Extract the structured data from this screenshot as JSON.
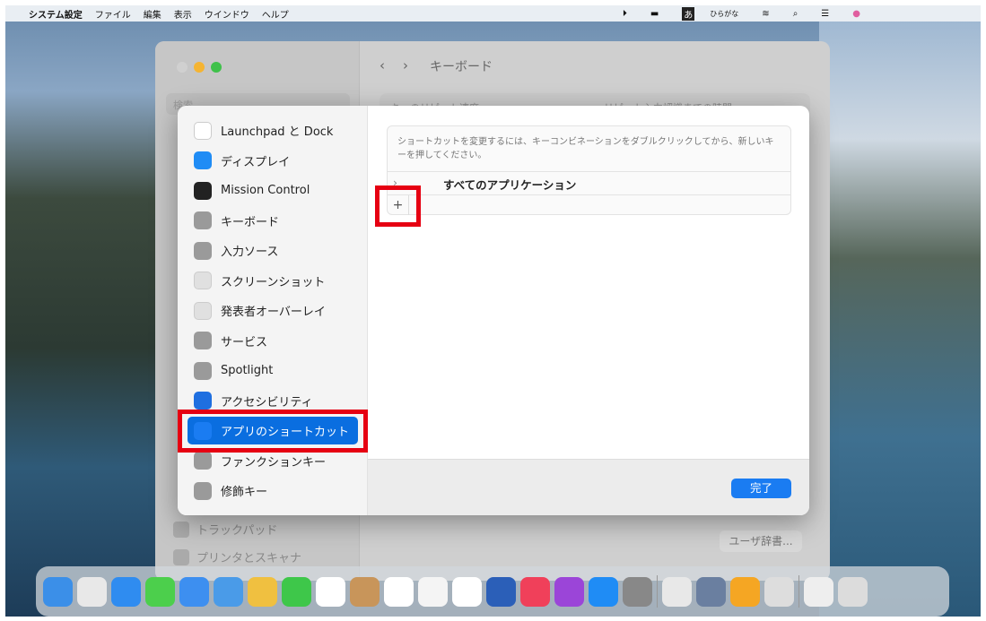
{
  "menubar": {
    "app": "システム設定",
    "items": [
      "ファイル",
      "編集",
      "表示",
      "ウインドウ",
      "ヘルプ"
    ],
    "input_mode_badge": "あ",
    "input_mode": "ひらがな",
    "icons": [
      "play-circle-icon",
      "battery-icon",
      "wifi-icon",
      "search-icon",
      "control-center-icon",
      "siri-icon"
    ]
  },
  "window": {
    "title": "キーボード",
    "back": "‹",
    "forward": "›",
    "search_placeholder": "検索",
    "bg_row_left": "キーのリピート速度",
    "bg_row_right": "リピート入力認識までの時間",
    "bg_sidebar": [
      "トラックパッド",
      "プリンタとスキャナ"
    ],
    "user_dict_button": "ユーザ辞書..."
  },
  "sheet": {
    "sidebar": [
      {
        "label": "Launchpad と Dock",
        "icon": "launchpad-icon",
        "color": "#ffffff"
      },
      {
        "label": "ディスプレイ",
        "icon": "display-icon",
        "color": "#1f8cf5"
      },
      {
        "label": "Mission Control",
        "icon": "mission-control-icon",
        "color": "#222222"
      },
      {
        "label": "キーボード",
        "icon": "keyboard-icon",
        "color": "#9a9a9a"
      },
      {
        "label": "入力ソース",
        "icon": "input-source-icon",
        "color": "#9a9a9a"
      },
      {
        "label": "スクリーンショット",
        "icon": "screenshot-icon",
        "color": "#e0e0e0"
      },
      {
        "label": "発表者オーバーレイ",
        "icon": "presenter-overlay-icon",
        "color": "#e0e0e0"
      },
      {
        "label": "サービス",
        "icon": "services-icon",
        "color": "#9a9a9a"
      },
      {
        "label": "Spotlight",
        "icon": "spotlight-icon",
        "color": "#9a9a9a"
      },
      {
        "label": "アクセシビリティ",
        "icon": "accessibility-icon",
        "color": "#1f6fe0"
      },
      {
        "label": "アプリのショートカット",
        "icon": "app-store-icon",
        "color": "#1a7cf2",
        "selected": true
      },
      {
        "label": "ファンクションキー",
        "icon": "fn-key-icon",
        "color": "#9a9a9a"
      },
      {
        "label": "修飾キー",
        "icon": "modifier-key-icon",
        "color": "#9a9a9a"
      }
    ],
    "help_text": "ショートカットを変更するには、キーコンビネーションをダブルクリックしてから、新しいキーを押してください。",
    "row_label": "すべてのアプリケーション",
    "row_chevron": "›",
    "add_button": "+",
    "done_button": "完了"
  },
  "dock": [
    "finder",
    "launchpad",
    "safari",
    "messages",
    "mail",
    "maps",
    "photos",
    "facetime",
    "calendar",
    "contacts",
    "reminders",
    "notes",
    "freeform",
    "word",
    "music",
    "podcasts",
    "app-store",
    "system-settings",
    "preview",
    "scanner",
    "pages",
    "downloads",
    "finder-window",
    "trash"
  ],
  "highlight_color": "#e60012"
}
